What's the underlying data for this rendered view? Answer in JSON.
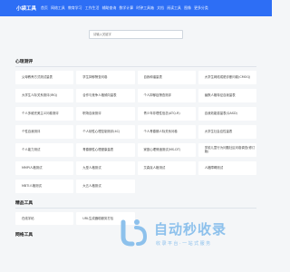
{
  "header": {
    "brand": "小袋工具",
    "nav": [
      "首页",
      "网络工具",
      "教育学习",
      "工作生活",
      "辅助查询",
      "数学计算",
      "时钟工具箱",
      "文档",
      "阅读工具",
      "图像",
      "更多分类"
    ]
  },
  "search": {
    "placeholder": "请输入关键字"
  },
  "sections": [
    {
      "title": "心理测评",
      "items": [
        "父母教养方式测试量表",
        "学生抑郁筛查问卷",
        "自我和谐量表",
        "大学生网络成瘾诊断问卷(CMOQ)",
        "大学生人际关系测评(IRQ)",
        "合作与竞争人格倾向量表",
        "个人抑郁症筛查测评",
        "幽默人格特征自我量表",
        "个人多维完美主义问卷测评",
        "职场自我测评",
        "青少年非理性信念(ATQ-R)",
        "自我效能感量表(QASD)",
        "个性自我测评",
        "个人韧性心理控制测评(4C)",
        "个人青春期人际关系问卷",
        "大学生社会应性量表",
        "个人能力测试",
        "青春期性心理健康量表",
        "家庭心理情绪测试(MS-DT)",
        "学前儿童行为问题社区问卷调查(修订版)",
        "MMPI人格测试",
        "九型人格测试",
        "艾森克人格测试",
        "人格障碍测试",
        "MBTI人格测试",
        "大五人格测试"
      ]
    },
    {
      "title": "精品工具",
      "items": [
        "在线字帖",
        "URL生成器助服务打包"
      ]
    },
    {
      "title": "网络工具",
      "items": []
    }
  ],
  "watermark": {
    "big": "自动秒收录",
    "small": "收录平台·一站式服务"
  }
}
